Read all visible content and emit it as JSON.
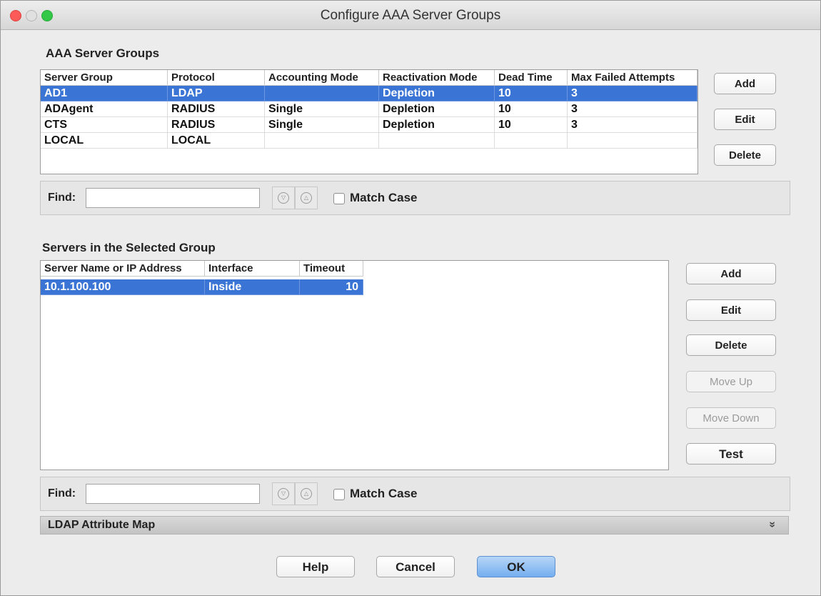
{
  "window": {
    "title": "Configure AAA Server Groups"
  },
  "groups": {
    "label": "AAA Server Groups",
    "columns": [
      "Server Group",
      "Protocol",
      "Accounting Mode",
      "Reactivation Mode",
      "Dead Time",
      "Max Failed Attempts"
    ],
    "rows": [
      [
        "AD1",
        "LDAP",
        "",
        "Depletion",
        "10",
        "3"
      ],
      [
        "ADAgent",
        "RADIUS",
        "Single",
        "Depletion",
        "10",
        "3"
      ],
      [
        "CTS",
        "RADIUS",
        "Single",
        "Depletion",
        "10",
        "3"
      ],
      [
        "LOCAL",
        "LOCAL",
        "",
        "",
        "",
        ""
      ]
    ],
    "selected_row": 0,
    "buttons": {
      "add": "Add",
      "edit": "Edit",
      "delete": "Delete"
    },
    "find": {
      "label": "Find:",
      "value": "",
      "match_case": "Match Case"
    }
  },
  "servers": {
    "label": "Servers in the Selected Group",
    "columns": [
      "Server Name or IP Address",
      "Interface",
      "Timeout"
    ],
    "rows": [
      [
        "10.1.100.100",
        "Inside",
        "10"
      ]
    ],
    "selected_row": 0,
    "buttons": {
      "add": "Add",
      "edit": "Edit",
      "delete": "Delete",
      "move_up": "Move Up",
      "move_down": "Move Down",
      "test": "Test"
    },
    "find": {
      "label": "Find:",
      "value": "",
      "match_case": "Match Case"
    }
  },
  "ldap_section": {
    "label": "LDAP Attribute Map",
    "icon": "double-chevron-down-icon"
  },
  "footer": {
    "help": "Help",
    "cancel": "Cancel",
    "ok": "OK"
  },
  "colors": {
    "selection": "#3a74d4",
    "ok_button": "#74aef0"
  }
}
